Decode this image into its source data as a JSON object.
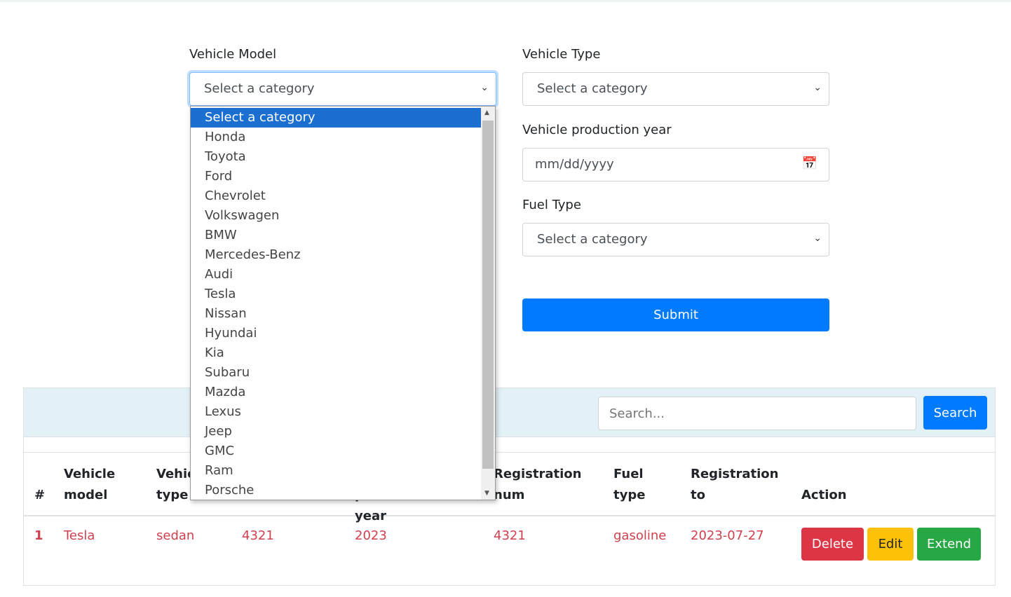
{
  "form": {
    "vehicle_model": {
      "label": "Vehicle Model",
      "value": "Select a category"
    },
    "vehicle_type": {
      "label": "Vehicle Type",
      "value": "Select a category"
    },
    "production_year": {
      "label": "Vehicle production year",
      "placeholder": "mm/dd/yyyy"
    },
    "fuel_type": {
      "label": "Fuel Type",
      "value": "Select a category"
    },
    "submit_label": "Submit"
  },
  "dropdown": {
    "options": [
      "Select a category",
      "Honda",
      "Toyota",
      "Ford",
      "Chevrolet",
      "Volkswagen",
      "BMW",
      "Mercedes-Benz",
      "Audi",
      "Tesla",
      "Nissan",
      "Hyundai",
      "Kia",
      "Subaru",
      "Mazda",
      "Lexus",
      "Jeep",
      "GMC",
      "Ram",
      "Porsche"
    ],
    "selected": "Select a category"
  },
  "table": {
    "search_placeholder": "Search...",
    "search_button": "Search",
    "headers": [
      "#",
      "Vehicle model",
      "Vehicle type",
      "",
      "Vehicle production year",
      "Registration num",
      "Fuel type",
      "Registration to",
      "Action"
    ],
    "rows": [
      {
        "num": "1",
        "model": "Tesla",
        "type": "sedan",
        "c4": "4321",
        "year": "2023",
        "reg": "4321",
        "fuel": "gasoline",
        "to": "2023-07-27"
      }
    ],
    "actions": {
      "delete": "Delete",
      "edit": "Edit",
      "extend": "Extend"
    }
  },
  "colors": {
    "primary": "#007bff",
    "danger": "#dc3545",
    "warning": "#ffc107",
    "success": "#28a745",
    "toolbar": "#e3f1f6"
  }
}
